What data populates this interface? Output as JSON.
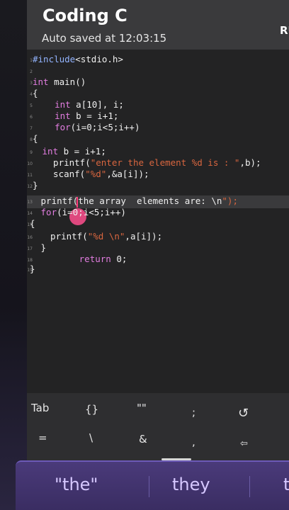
{
  "header": {
    "title": "Coding C",
    "subtitle": "Auto saved at 12:03:15",
    "run_label": "RU"
  },
  "editor": {
    "lines": [
      {
        "n": "1",
        "segments": [
          {
            "t": "#include",
            "c": "pp"
          },
          {
            "t": "<stdio.h>",
            "c": ""
          }
        ]
      },
      {
        "n": "2",
        "segments": []
      },
      {
        "n": "3",
        "segments": [
          {
            "t": "int",
            "c": "kw"
          },
          {
            "t": " main()",
            "c": ""
          }
        ]
      },
      {
        "n": "4",
        "segments": [
          {
            "t": "{",
            "c": ""
          }
        ]
      },
      {
        "n": "5",
        "segments": [
          {
            "t": "  ",
            "c": ""
          },
          {
            "t": "int",
            "c": "kw"
          },
          {
            "t": " a[10], i;",
            "c": ""
          }
        ]
      },
      {
        "n": "6",
        "segments": [
          {
            "t": "  ",
            "c": ""
          },
          {
            "t": "int",
            "c": "kw"
          },
          {
            "t": " b = i+1;",
            "c": ""
          }
        ]
      },
      {
        "n": "7",
        "segments": [
          {
            "t": "  ",
            "c": ""
          },
          {
            "t": "for",
            "c": "kw"
          },
          {
            "t": "(i=0;i<5;i++)",
            "c": ""
          }
        ]
      },
      {
        "n": "8",
        "segments": [
          {
            "t": "{",
            "c": ""
          }
        ]
      },
      {
        "n": "9",
        "segments": [
          {
            "t": " ",
            "c": ""
          },
          {
            "t": "int",
            "c": "kw"
          },
          {
            "t": " b = i+1;",
            "c": ""
          }
        ]
      },
      {
        "n": "10",
        "segments": [
          {
            "t": "  printf(",
            "c": ""
          },
          {
            "t": "\"enter the element %d is : \"",
            "c": "str"
          },
          {
            "t": ",b);",
            "c": ""
          }
        ]
      },
      {
        "n": "11",
        "segments": [
          {
            "t": "  scanf(",
            "c": ""
          },
          {
            "t": "\"%d\"",
            "c": "str"
          },
          {
            "t": ",&a[i]);",
            "c": ""
          }
        ]
      },
      {
        "n": "12",
        "segments": [
          {
            "t": "}",
            "c": ""
          }
        ]
      },
      {
        "n": "13",
        "segments": [
          {
            "t": " printf(the array  elements are: \\n",
            "c": ""
          },
          {
            "t": "\");",
            "c": "str"
          }
        ]
      },
      {
        "n": "14",
        "segments": [
          {
            "t": " ",
            "c": ""
          },
          {
            "t": "for",
            "c": "kw"
          },
          {
            "t": "(i=0;i<5;i++)",
            "c": ""
          }
        ]
      },
      {
        "n": "15",
        "segments": [
          {
            "t": "{",
            "c": ""
          }
        ]
      },
      {
        "n": "16",
        "segments": [
          {
            "t": "  printf(",
            "c": ""
          },
          {
            "t": "\"%d \\n\"",
            "c": "str"
          },
          {
            "t": ",a[i]);",
            "c": ""
          }
        ]
      },
      {
        "n": "17",
        "segments": [
          {
            "t": " }",
            "c": ""
          }
        ]
      },
      {
        "n": "18",
        "segments": [
          {
            "t": "     ",
            "c": ""
          },
          {
            "t": "return",
            "c": "kw"
          },
          {
            "t": " 0;",
            "c": ""
          }
        ]
      },
      {
        "n": "19",
        "segments": [
          {
            "t": "}",
            "c": ""
          }
        ]
      }
    ]
  },
  "keys": {
    "row1": [
      "Tab",
      "{}",
      "\"\"",
      ";",
      "↺"
    ],
    "row2": [
      "=",
      "\\",
      "&",
      ",",
      "⇦"
    ]
  },
  "suggestions": [
    "\"the\"",
    "they",
    "t"
  ],
  "colors": {
    "keyword": "#e27de0",
    "string": "#d9663f",
    "preprocessor": "#93b4ff",
    "suggestion_bar": "#4a3a7a"
  }
}
